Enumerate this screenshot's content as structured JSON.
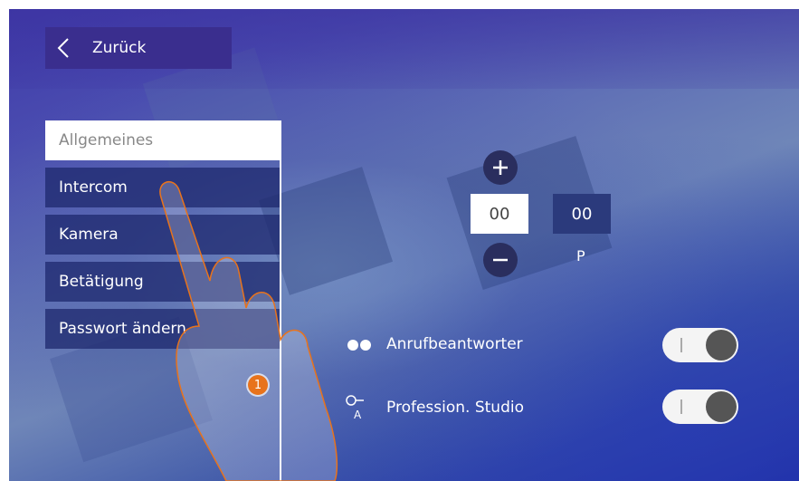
{
  "header": {
    "back_label": "Zurück"
  },
  "menu": {
    "items": [
      {
        "label": "Allgemeines",
        "active": true
      },
      {
        "label": "Intercom",
        "active": false
      },
      {
        "label": "Kamera",
        "active": false
      },
      {
        "label": "Betätigung",
        "active": false
      },
      {
        "label": "Passwort ändern",
        "active": false
      }
    ]
  },
  "address": {
    "value_main": "00",
    "value_p": "00",
    "p_label": "P"
  },
  "settings": {
    "answering_machine_label": "Anrufbeantworter",
    "professional_studio_label": "Profession. Studio",
    "toggle_on_mark": "I"
  },
  "callout": {
    "step_number": "1"
  },
  "colors": {
    "accent": "#e8731c",
    "header_button": "#3a2e8e",
    "menu_item_bg": "#1e286e"
  }
}
